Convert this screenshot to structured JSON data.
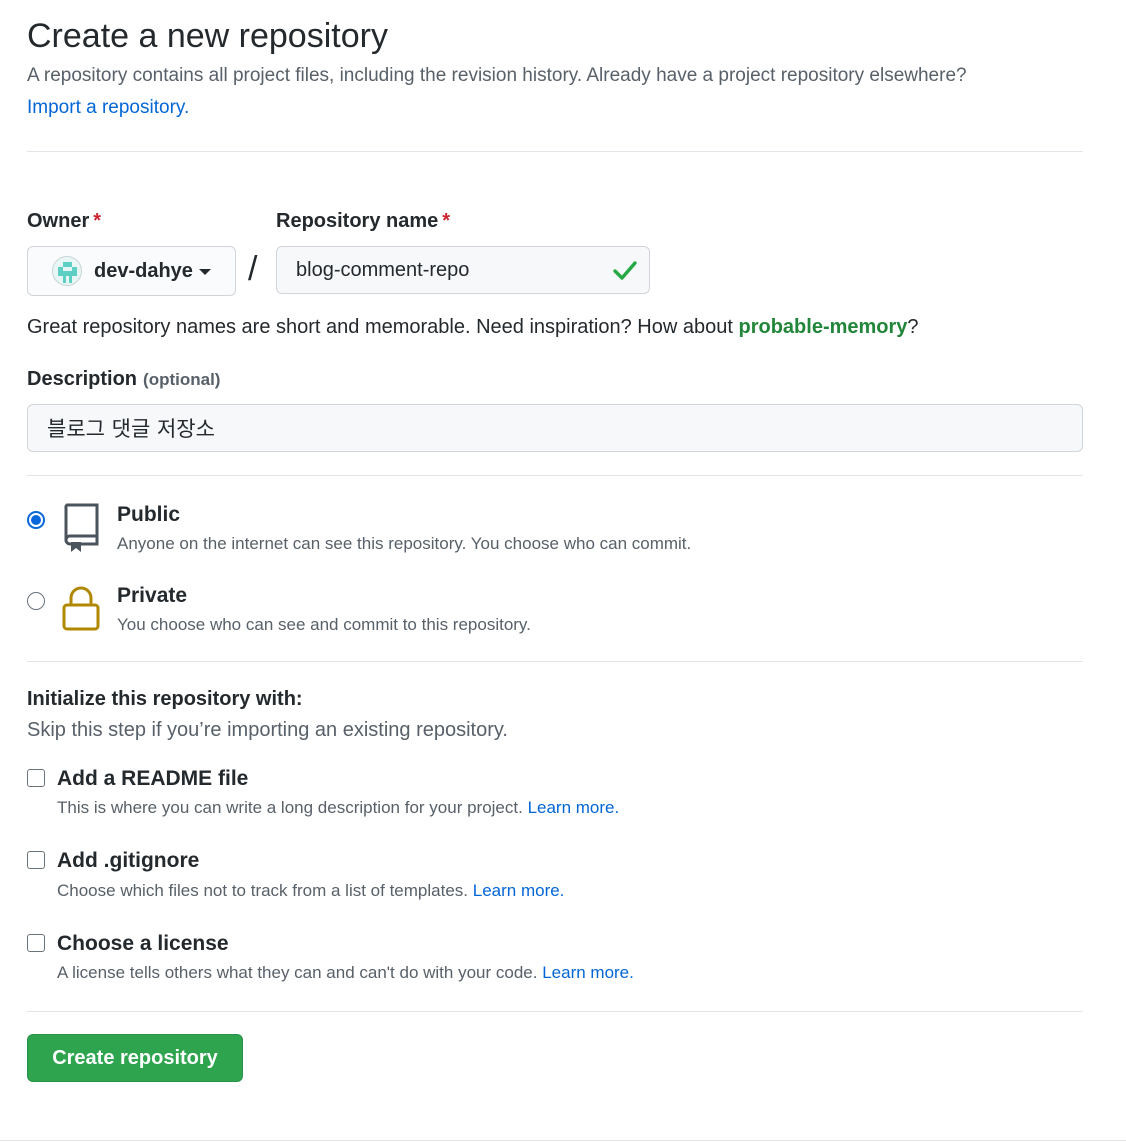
{
  "header": {
    "title": "Create a new repository",
    "subtitle": "A repository contains all project files, including the revision history. Already have a project repository elsewhere?",
    "import_link": "Import a repository."
  },
  "owner": {
    "label": "Owner",
    "required_mark": "*",
    "name": "dev-dahye"
  },
  "repo_name": {
    "label": "Repository name",
    "required_mark": "*",
    "value": "blog-comment-repo"
  },
  "separator": "/",
  "hint": {
    "text": "Great repository names are short and memorable. Need inspiration? How about ",
    "suggestion": "probable-memory",
    "suffix": "?"
  },
  "description": {
    "label": "Description",
    "optional": "(optional)",
    "value": "블로그 댓글 저장소"
  },
  "visibility": {
    "selected": "public",
    "public": {
      "title": "Public",
      "desc": "Anyone on the internet can see this repository. You choose who can commit."
    },
    "private": {
      "title": "Private",
      "desc": "You choose who can see and commit to this repository."
    }
  },
  "initialize": {
    "title": "Initialize this repository with:",
    "subtitle": "Skip this step if you’re importing an existing repository.",
    "options": [
      {
        "title": "Add a README file",
        "desc": "This is where you can write a long description for your project.",
        "link": "Learn more."
      },
      {
        "title": "Add .gitignore",
        "desc": "Choose which files not to track from a list of templates.",
        "link": "Learn more."
      },
      {
        "title": "Choose a license",
        "desc": "A license tells others what they can and can't do with your code.",
        "link": "Learn more."
      }
    ]
  },
  "create_button": "Create repository",
  "colors": {
    "link": "#0366d6",
    "success": "#22863a",
    "button": "#2ea44f",
    "required": "#cb2431",
    "lock": "#b08800"
  }
}
